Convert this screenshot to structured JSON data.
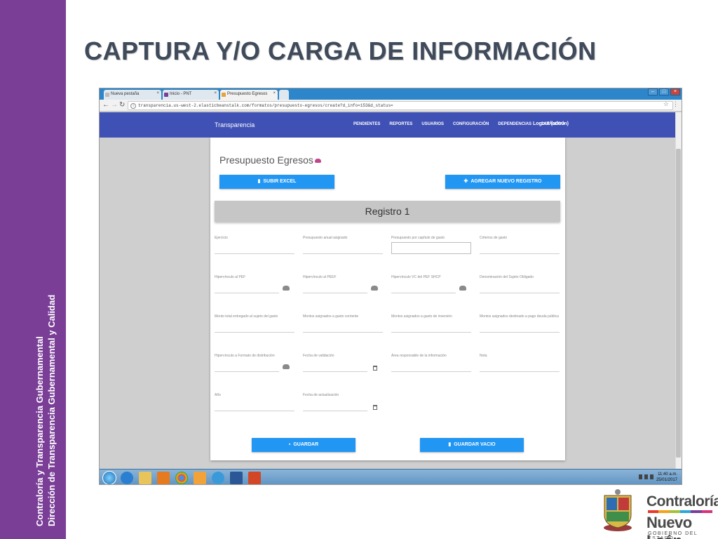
{
  "slide": {
    "title": "CAPTURA Y/O CARGA DE INFORMACIÓN",
    "side_line1": "Contraloría  y Transparencia Gubernamental",
    "side_line2": "Dirección de Transparencia Gubernamental y Calidad",
    "accent_color": "#7a3e97"
  },
  "browser": {
    "tabs": [
      {
        "label": "Nueva pestaña",
        "icon": "blank-page-icon"
      },
      {
        "label": "Inicio - PNT",
        "icon": "pnt-icon"
      },
      {
        "label": "Presupuesto Egresos",
        "icon": "app-icon",
        "active": true
      }
    ],
    "url": "transparencia.us-west-2.elasticbeanstalk.com/formatos/presupuesto-egresos/create?d_info=153&d_status="
  },
  "app": {
    "brand": "Transparencia",
    "menu": [
      "PENDIENTES",
      "REPORTES",
      "USUARIOS",
      "CONFIGURACIÓN",
      "DEPENDENCIAS",
      "CATÁLOGO"
    ],
    "logout": "Logout (admin)",
    "header_color": "#3f51b5"
  },
  "form": {
    "title": "Presupuesto Egresos",
    "upload_button": "SUBIR EXCEL",
    "add_button": "AGREGAR NUEVO REGISTRO",
    "section_title": "Registro 1",
    "fields": [
      {
        "label": "Ejercicio"
      },
      {
        "label": "Presupuesto anual asignado"
      },
      {
        "label": "Presupuesto por capítulo de gasto"
      },
      {
        "label": "Criterios de gasto"
      },
      {
        "label": "Hipervínculo al PEF"
      },
      {
        "label": "Hipervínculo al PEEF"
      },
      {
        "label": "Hipervínculo VC del PEF SHCP"
      },
      {
        "label": "Denominación del Sujeto Obligado"
      },
      {
        "label": "Monto total entregado al sujeto del gasto"
      },
      {
        "label": "Montos asignados a gasto corriente"
      },
      {
        "label": "Montos asignados a gasto de inversión"
      },
      {
        "label": "Montos asignados destinado a pago deuda pública"
      },
      {
        "label": "Hipervínculo a Formato de distribución"
      },
      {
        "label": "Fecha de validación"
      },
      {
        "label": "Área responsable de la información"
      },
      {
        "label": "Nota"
      },
      {
        "label": "Año"
      },
      {
        "label": "Fecha de actualización"
      }
    ],
    "save_button": "GUARDAR",
    "save_empty_button": "GUARDAR VACIO",
    "button_color": "#2196f3"
  },
  "taskbar": {
    "time": "11:40 a.m.",
    "date": "25/01/2017"
  },
  "logos": {
    "org1": "Contraloría",
    "org2": "Nuevo León",
    "org3": "GOBIERNO DEL ESTADO"
  }
}
